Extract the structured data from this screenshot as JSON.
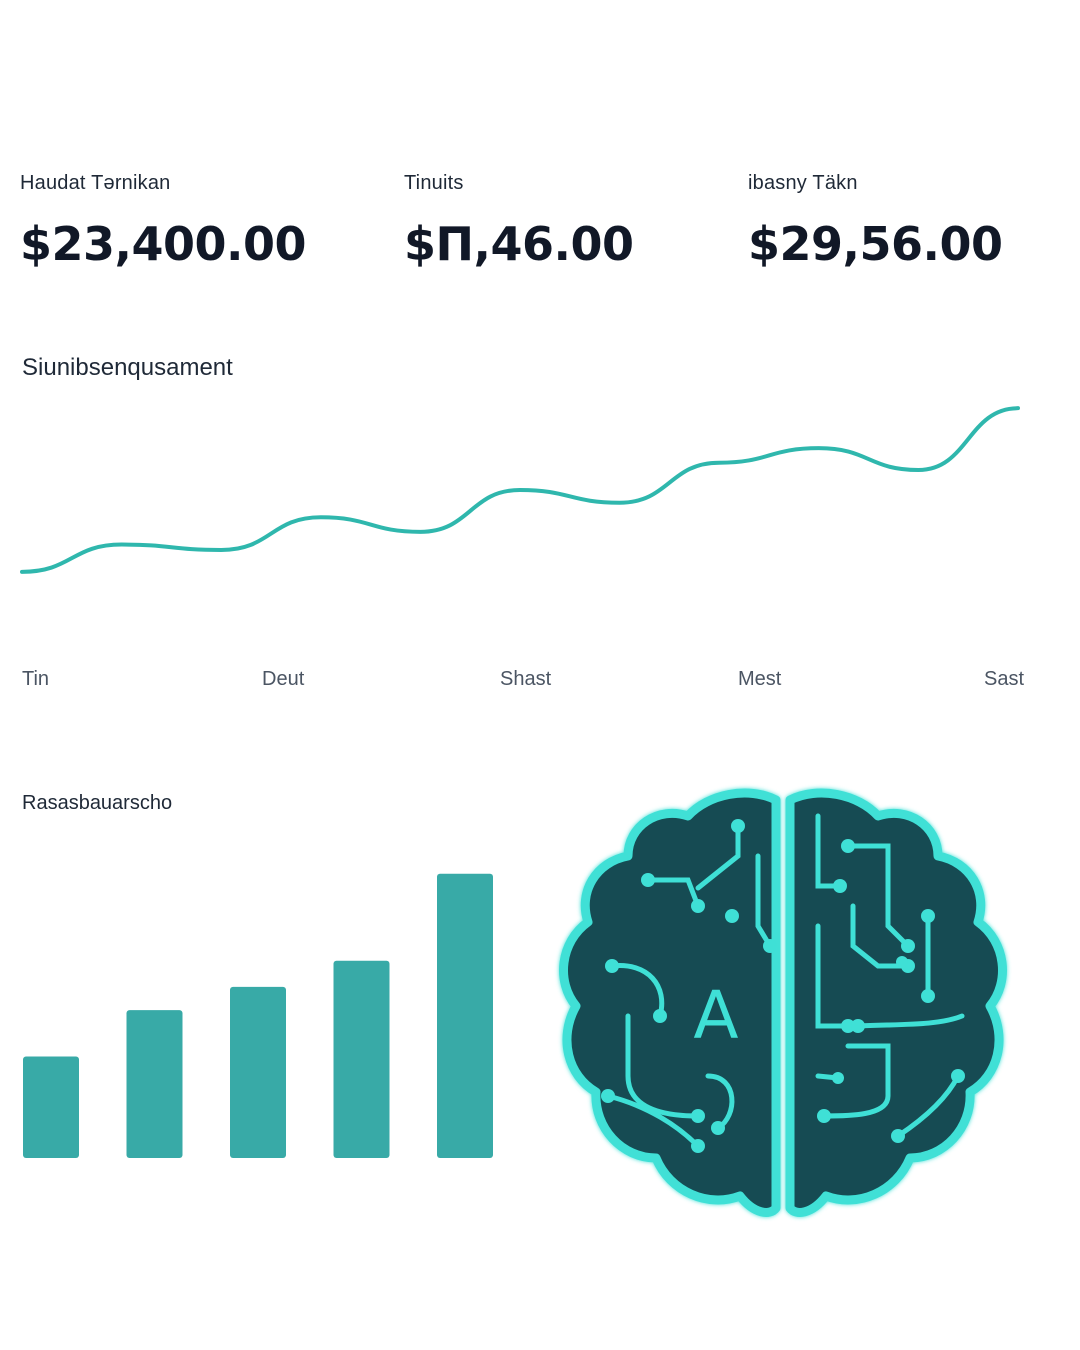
{
  "stats": [
    {
      "label": "Haudat Tǝrnikan",
      "value": "$23,400.00"
    },
    {
      "label": "Tinuits",
      "value": "$Π,46.00"
    },
    {
      "label": "ibasny Täkn",
      "value": "$29,56.00"
    }
  ],
  "line_section": {
    "title": "Siunibsenqusament"
  },
  "bar_section": {
    "title": "Rasasbauarscho"
  },
  "brain_logo": {
    "letter": "A",
    "icon": "ai-brain-circuit-icon"
  },
  "colors": {
    "accent": "#2fb7ad",
    "bar": "#38aaa7",
    "brain_fill": "#134b52",
    "brain_line": "#3fe0d6"
  },
  "chart_data": [
    {
      "type": "line",
      "title": "Siunibsenqusament",
      "x": [
        "Tin",
        "Deut",
        "Shast",
        "Mest",
        "Sast"
      ],
      "values": [
        10,
        25,
        22,
        40,
        32,
        55,
        48,
        70,
        78,
        66,
        100
      ],
      "ylim": [
        0,
        110
      ],
      "grid": false
    },
    {
      "type": "bar",
      "title": "Rasasbauarscho",
      "categories": [
        "",
        "",
        "",
        "",
        ""
      ],
      "values": [
        35,
        51,
        59,
        68,
        98
      ],
      "ylim": [
        0,
        100
      ],
      "grid": false
    }
  ]
}
